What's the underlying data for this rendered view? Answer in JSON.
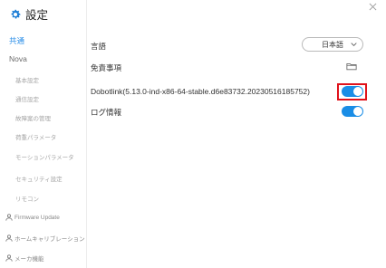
{
  "sidebar": {
    "title": "設定",
    "title_icon": "gear-icon",
    "items": [
      {
        "label": "共通",
        "kind": "group",
        "active": true
      },
      {
        "label": "Nova",
        "kind": "group",
        "active": false
      },
      {
        "label": "基本設定",
        "kind": "sub"
      },
      {
        "label": "通信設定",
        "kind": "sub"
      },
      {
        "label": "故障案の管理",
        "kind": "sub"
      },
      {
        "label": "荷重パラメータ",
        "kind": "sub"
      },
      {
        "label": "モーションパラメータ",
        "kind": "sub"
      },
      {
        "label": "セキュリティ設定",
        "kind": "sub"
      },
      {
        "label": "リモコン",
        "kind": "sub"
      },
      {
        "label": "Firmware Update",
        "kind": "icon-row",
        "icon": "user-icon"
      },
      {
        "label": "ホームキャリブレーション",
        "kind": "icon-row",
        "icon": "user-icon"
      },
      {
        "label": "メーカ機能",
        "kind": "icon-row",
        "icon": "user-icon"
      }
    ]
  },
  "main": {
    "language_label": "言語",
    "language_value": "日本語",
    "disclaimer_label": "免責事項",
    "dobotlink_label": "Dobotlink(5.13.0-ind-x86-64-stable.d6e83732.20230516185752)",
    "dobotlink_enabled": true,
    "log_label": "ログ情報",
    "log_enabled": true
  },
  "colors": {
    "accent": "#1a8de6",
    "active_nav": "#2a8ee8",
    "highlight": "#e0121b"
  }
}
